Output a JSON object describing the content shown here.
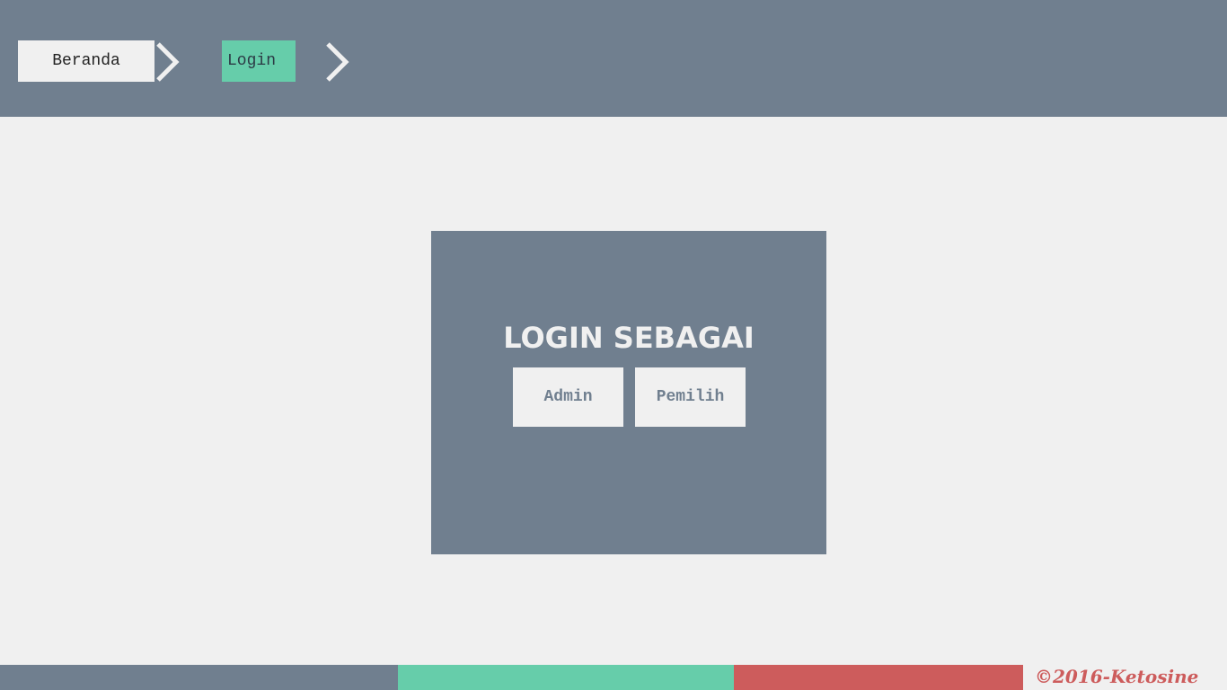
{
  "nav": {
    "items": [
      {
        "label": "Beranda",
        "active": false
      },
      {
        "label": "Login",
        "active": true
      }
    ],
    "separator_icon": "chevron-right-icon"
  },
  "login_panel": {
    "title": "LOGIN SEBAGAI",
    "buttons": [
      {
        "label": "Admin"
      },
      {
        "label": "Pemilih"
      }
    ]
  },
  "footer": {
    "copyright": "©2016-Ketosine",
    "stripe_colors": [
      "#707f8f",
      "#66cdaa",
      "#cd5c5c"
    ]
  },
  "colors": {
    "header_bg": "#707f8f",
    "page_bg": "#f0f0f0",
    "accent_green": "#66cdaa",
    "accent_red": "#cd5c5c"
  }
}
